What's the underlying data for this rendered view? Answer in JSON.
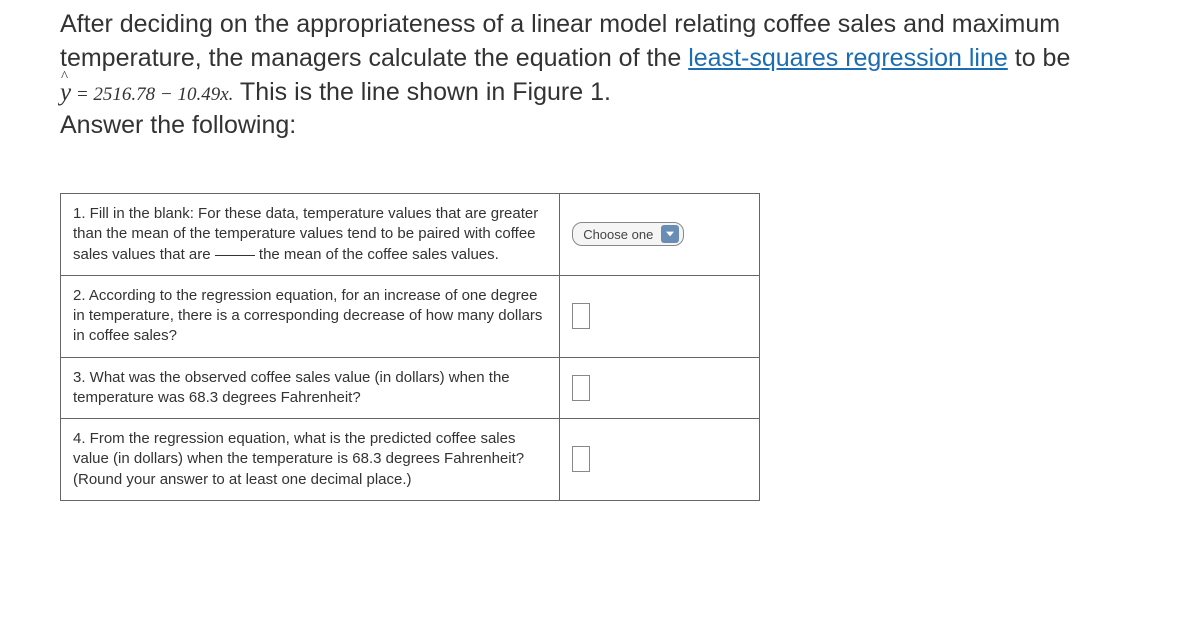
{
  "intro": {
    "part1": "After deciding on the appropriateness of a linear model relating coffee sales and maximum temperature, the managers calculate the equation of the ",
    "link_text": "least-squares regression line",
    "part2": " to be ",
    "eq_y": "y",
    "eq_rest": " = 2516.78 − 10.49x.",
    "part3": " This is the line shown in Figure 1.",
    "part4": "Answer the following:"
  },
  "questions": {
    "q1": {
      "prefix": "1. Fill in the blank: For these data, temperature values that are greater than the mean of the temperature values tend to be paired with coffee sales values that are ",
      "suffix": " the mean of the coffee sales values.",
      "select_label": "Choose one"
    },
    "q2": "2. According to the regression equation, for an increase of one degree in temperature, there is a corresponding decrease of how many dollars in coffee sales?",
    "q3": "3. What was the observed coffee sales value (in dollars) when the temperature was 68.3 degrees Fahrenheit?",
    "q4": "4. From the regression equation, what is the predicted coffee sales value (in dollars) when the temperature is 68.3 degrees Fahrenheit? (Round your answer to at least one decimal place.)"
  }
}
